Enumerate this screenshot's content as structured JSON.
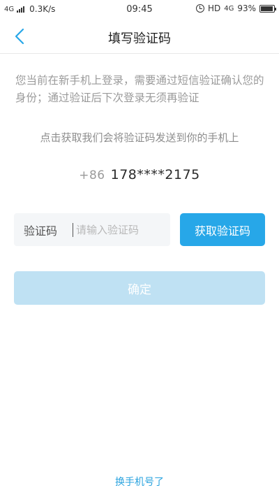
{
  "status_bar": {
    "network": "4G",
    "speed": "0.3K/s",
    "time": "09:45",
    "hd": "HD",
    "network2": "4G",
    "battery": "93%"
  },
  "nav": {
    "title": "填写验证码"
  },
  "notice": "您当前在新手机上登录，需要通过短信验证确认您的身份；通过验证后下次登录无须再验证",
  "hint": "点击获取我们会将验证码发送到你的手机上",
  "phone": {
    "prefix": "+86",
    "number": "178****2175"
  },
  "code_field": {
    "label": "验证码",
    "placeholder": "请输入验证码",
    "value": ""
  },
  "get_code_button": "获取验证码",
  "confirm_button": "确定",
  "change_phone_link": "换手机号了",
  "colors": {
    "accent": "#27a7e8",
    "confirm_disabled": "#bfe1f3",
    "link": "#2aa3df"
  },
  "icons": {
    "back": "chevron-left-icon",
    "alarm": "alarm-icon",
    "battery": "battery-icon",
    "signal": "signal-icon"
  }
}
